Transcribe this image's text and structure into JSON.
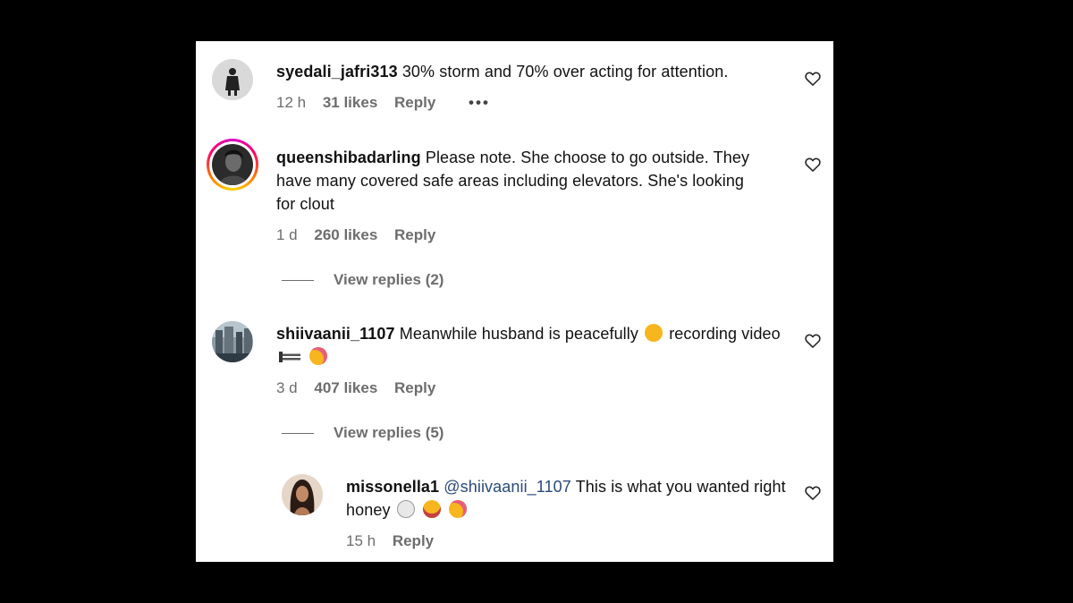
{
  "comments": [
    {
      "username": "syedali_jafri313",
      "text": "30% storm and 70% over acting for attention.",
      "time": "12 h",
      "likes": "31 likes",
      "reply": "Reply",
      "more": "•••"
    },
    {
      "username": "queenshibadarling",
      "text": "Please note. She choose to go outside. They have many covered safe areas including elevators. She's looking for clout",
      "time": "1 d",
      "likes": "260 likes",
      "reply": "Reply",
      "view_replies": "View replies (2)"
    },
    {
      "username": "shiivaanii_1107",
      "text_a": "Meanwhile husband is peacefully",
      "text_b": "recording video",
      "emojis": [
        "pensive-face",
        "video-camera",
        "rolling-laughing-face"
      ],
      "time": "3 d",
      "likes": "407 likes",
      "reply": "Reply",
      "view_replies": "View replies (5)"
    }
  ],
  "reply": {
    "username": "missonella1",
    "mention": "@shiivaanii_1107",
    "text": "This is what you wanted right honey",
    "emojis": [
      "skull",
      "joy-face",
      "rolling-laughing-face"
    ],
    "time": "15 h",
    "reply": "Reply"
  },
  "colors": {
    "background": "#000000",
    "panel": "#ffffff",
    "text": "#111111",
    "meta": "#6d6d6d",
    "mention": "#2a4a78",
    "story_ring": [
      "#d300c5",
      "#ff0069",
      "#ff7a00",
      "#ffd600"
    ],
    "emoji_yellow": "#f7b51e"
  }
}
